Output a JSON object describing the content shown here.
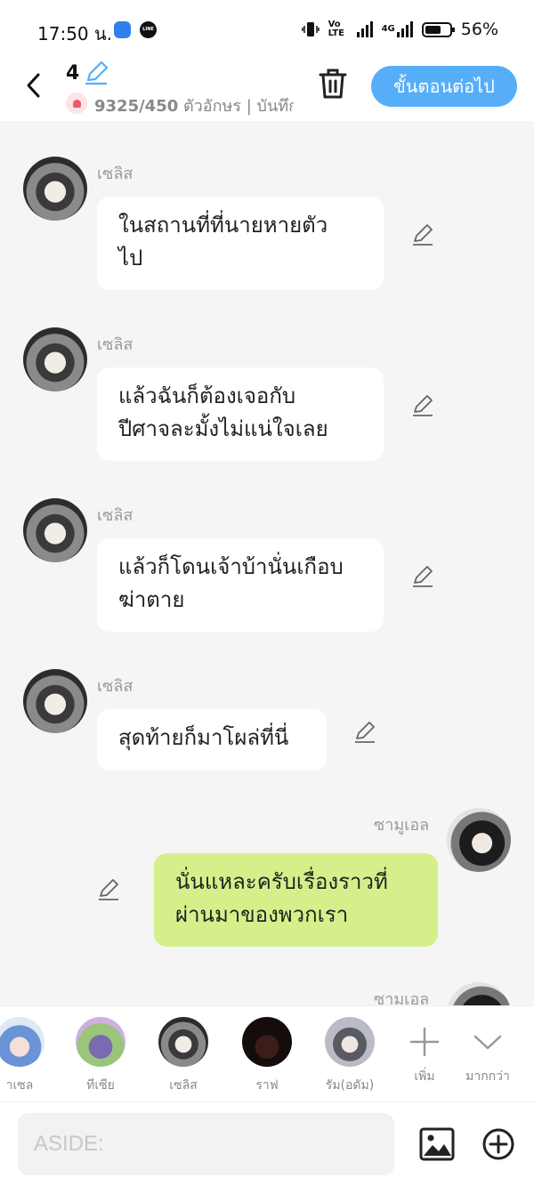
{
  "status_bar": {
    "time": "17:50 น.",
    "app2_label": "LINE",
    "volte_label": "Vo LTE",
    "net_label": "4G",
    "battery": "56%"
  },
  "header": {
    "chapter_number": "4",
    "count_current": "9325/450",
    "count_suffix": " ตัวอักษร | บันทึก",
    "next_label": "ขั้นตอนต่อไป"
  },
  "messages": [
    {
      "sender": "เซลิส",
      "text": "ในสถานที่ที่นายหายตัว\nไป",
      "mine": false
    },
    {
      "sender": "เซลิส",
      "text": "แล้วฉันก็ต้องเจอกับ\nปีศาจละมั้งไม่แน่ใจเลย",
      "mine": false
    },
    {
      "sender": "เซลิส",
      "text": "แล้วก็โดนเจ้าบ้านั่นเกือบ\nฆ่าตาย",
      "mine": false
    },
    {
      "sender": "เซลิส",
      "text": "สุดท้ายก็มาโผล่ที่นี่",
      "mine": false
    },
    {
      "sender": "ซามูเอล",
      "text": "นั่นแหละครับเรื่องราวที่\nผ่านมาของพวกเรา",
      "mine": true
    },
    {
      "sender": "ซามูเอล",
      "text": "",
      "mine": true
    }
  ],
  "characters": [
    {
      "name": "าเซล"
    },
    {
      "name": "ทีเซีย"
    },
    {
      "name": "เซลิส"
    },
    {
      "name": "ราฟ"
    },
    {
      "name": "รัม(อดัม)"
    }
  ],
  "actions": {
    "add_label": "เพิ่ม",
    "more_label": "มากกว่า"
  },
  "input": {
    "placeholder": "ASIDE:",
    "value": ""
  }
}
